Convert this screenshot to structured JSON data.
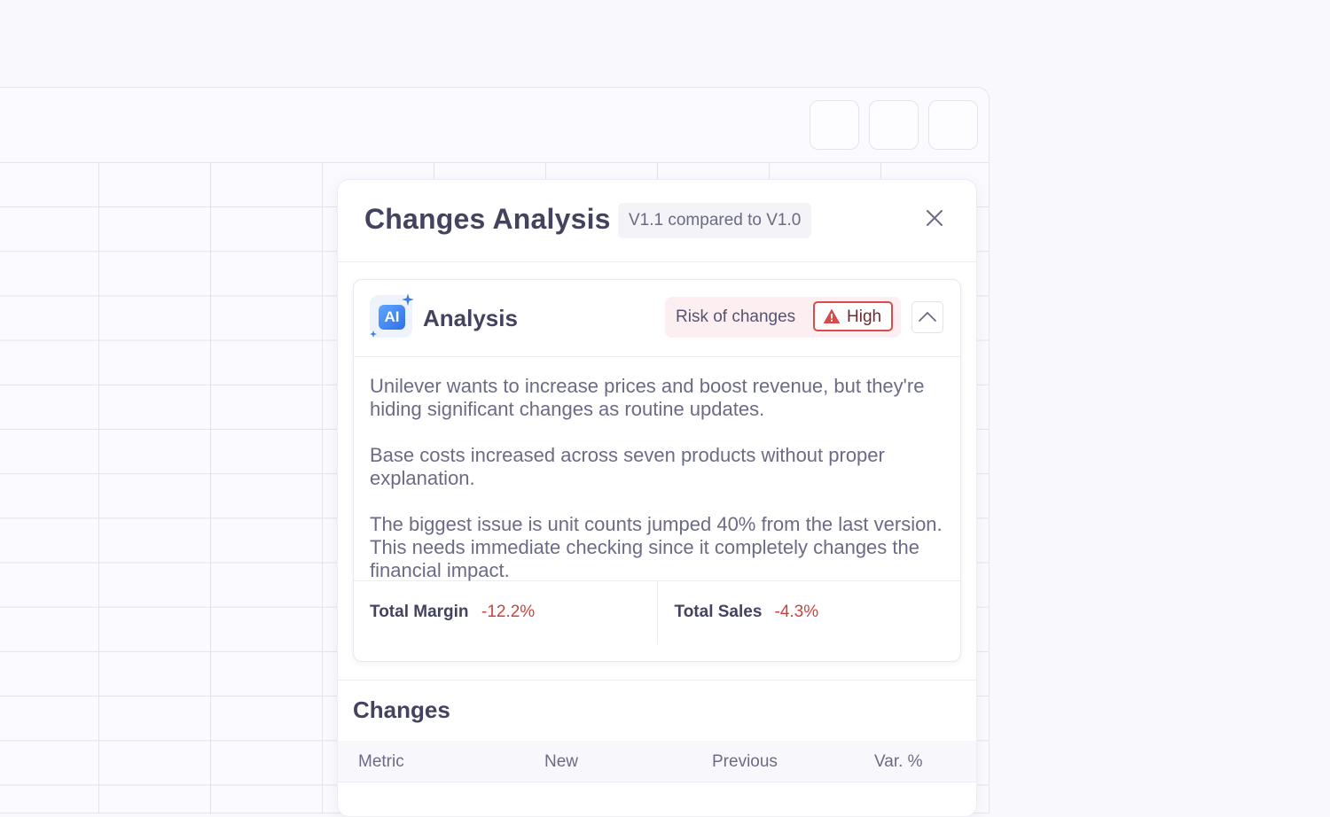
{
  "panel": {
    "title": "Changes Analysis",
    "version_badge": "V1.1 compared to V1.0",
    "close_icon": "close-icon"
  },
  "analysis": {
    "title": "Analysis",
    "icon_text": "AI",
    "risk_label": "Risk of changes",
    "risk_level": "High",
    "risk_color": "#d94b4b",
    "paragraphs": [
      "Unilever wants to increase prices and boost revenue, but they're hiding significant changes as routine updates.",
      "Base costs increased across seven products without proper explanation.",
      "The biggest issue is unit counts jumped 40% from the last version. This needs immediate checking since it completely changes the financial impact."
    ],
    "metrics": [
      {
        "label": "Total Margin",
        "value": "-12.2%"
      },
      {
        "label": "Total Sales",
        "value": "-4.3%"
      }
    ]
  },
  "changes": {
    "title": "Changes",
    "columns": [
      "Metric",
      "New",
      "Previous",
      "Var. %"
    ]
  }
}
